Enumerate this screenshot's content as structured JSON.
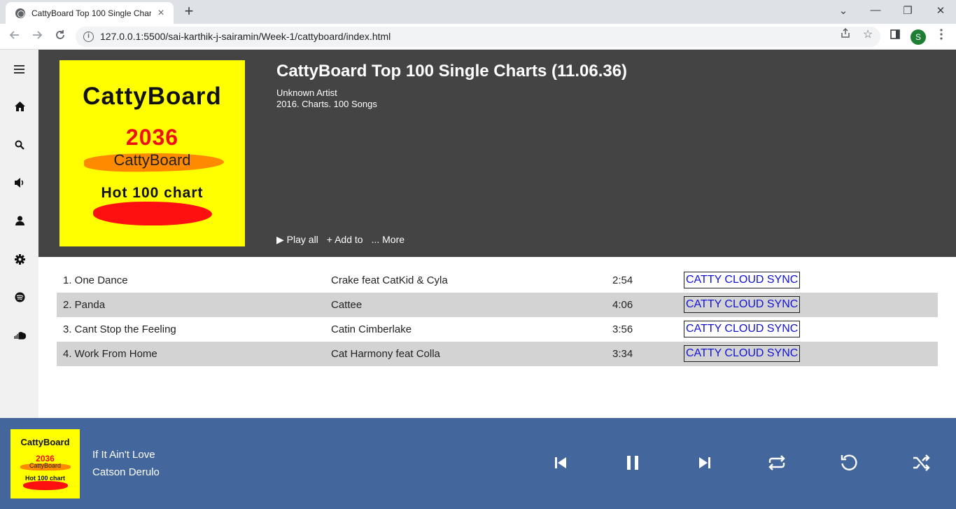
{
  "browser": {
    "tab_title": "CattyBoard Top 100 Single Charts",
    "url": "127.0.0.1:5500/sai-karthik-j-sairamin/Week-1/cattyboard/index.html",
    "profile_initial": "S",
    "new_tab": "+",
    "tab_close": "×",
    "window_controls": [
      "⌄",
      "—",
      "❐",
      "✕"
    ]
  },
  "sidebar": {
    "icons": [
      "menu-icon",
      "home-icon",
      "search-icon",
      "volume-icon",
      "user-icon",
      "settings-icon",
      "spotify-icon",
      "soundcloud-icon"
    ]
  },
  "album": {
    "cover": {
      "brand": "CattyBoard",
      "year": "2036",
      "sub": "CattyBoard",
      "chart": "Hot 100 chart"
    },
    "title": "CattyBoard Top 100 Single Charts (11.06.36)",
    "artist": "Unknown Artist",
    "meta": "2016. Charts. 100 Songs",
    "actions": {
      "play_all": "▶ Play all",
      "add_to": "+ Add to",
      "more": "... More"
    }
  },
  "tracks": [
    {
      "title": "1. One Dance",
      "artist": "Crake feat CatKid & Cyla",
      "duration": "2:54",
      "sync": "CATTY CLOUD SYNC"
    },
    {
      "title": "2. Panda",
      "artist": "Cattee",
      "duration": "4:06",
      "sync": "CATTY CLOUD SYNC"
    },
    {
      "title": "3. Cant Stop the Feeling",
      "artist": "Catin Cimberlake",
      "duration": "3:56",
      "sync": "CATTY CLOUD SYNC"
    },
    {
      "title": "4. Work From Home",
      "artist": "Cat Harmony feat Colla",
      "duration": "3:34",
      "sync": "CATTY CLOUD SYNC"
    }
  ],
  "player": {
    "title": "If It Ain't Love",
    "artist": "Catson Derulo",
    "cover": {
      "brand": "CattyBoard",
      "year": "2036",
      "sub": "CattyBoard",
      "chart": "Hot 100 chart"
    }
  },
  "colors": {
    "hero_bg": "#444444",
    "sidebar_bg": "#f1f1f1",
    "row_alt_bg": "#d3d3d3",
    "player_bg": "#43679c",
    "cover_bg": "#ffff00",
    "sync_link": "#1212d6"
  }
}
